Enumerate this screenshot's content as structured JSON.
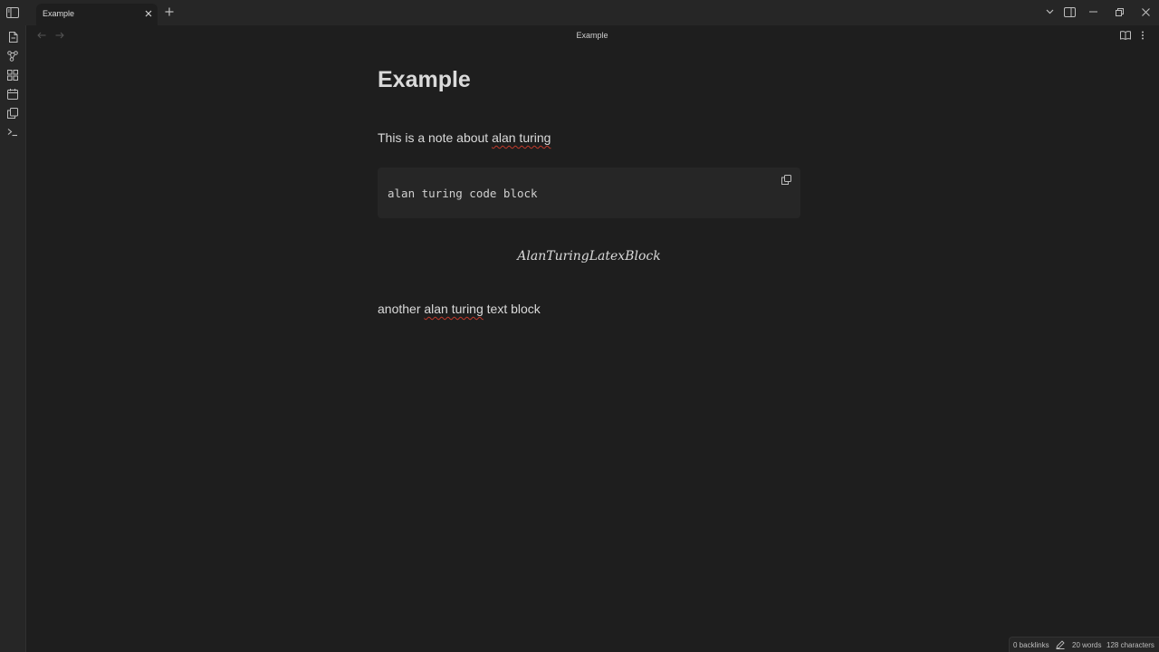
{
  "tab": {
    "title": "Example"
  },
  "view": {
    "title": "Example"
  },
  "note": {
    "heading": "Example",
    "para1_prefix": "This is a note about ",
    "para1_link": "alan turing",
    "code": "alan turing code block",
    "math": "AlanTuringLatexBlock",
    "para2_prefix": "another ",
    "para2_link": "alan turing",
    "para2_suffix": " text block"
  },
  "status": {
    "backlinks": "0 backlinks",
    "words": "20 words",
    "characters": "128 characters"
  },
  "icons": {
    "sidebar_toggle": "sidebar-toggle-icon",
    "tab_close": "close-icon",
    "new_tab": "plus-icon",
    "tab_list": "chevron-down-icon",
    "right_sidebar": "right-sidebar-icon",
    "minimize": "minimize-icon",
    "restore": "restore-icon",
    "close": "close-icon",
    "ribbon": [
      "file-icon",
      "graph-icon",
      "canvas-icon",
      "calendar-icon",
      "copy-icon",
      "terminal-icon"
    ],
    "back": "arrow-left-icon",
    "forward": "arrow-right-icon",
    "reading_view": "book-icon",
    "more_options": "more-vertical-icon",
    "copy_code": "copy-icon",
    "edit_mode": "pencil-icon"
  },
  "colors": {
    "background": "#1e1e1e",
    "chrome": "#262626",
    "text": "#dadada",
    "spellcheck": "#c0392b"
  }
}
